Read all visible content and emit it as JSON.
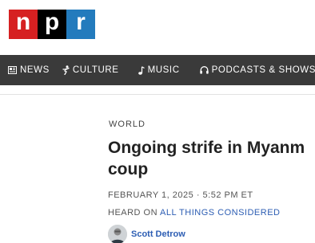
{
  "logo": {
    "letters": [
      "n",
      "p",
      "r"
    ],
    "colors": [
      "#d62021",
      "#000000",
      "#237bbd"
    ]
  },
  "nav": {
    "items": [
      {
        "label": "NEWS",
        "icon": "news-icon"
      },
      {
        "label": "CULTURE",
        "icon": "culture-icon"
      },
      {
        "label": "MUSIC",
        "icon": "music-icon"
      },
      {
        "label": "PODCASTS & SHOWS",
        "icon": "headphones-icon"
      }
    ]
  },
  "article": {
    "section": "WORLD",
    "headline_line1": "Ongoing strife in Myanm",
    "headline_line2": "coup",
    "date": "FEBRUARY 1, 2025 · 5:52 PM ET",
    "heard_on_label": "HEARD ON",
    "show": "ALL THINGS CONSIDERED",
    "author": "Scott Detrow"
  }
}
